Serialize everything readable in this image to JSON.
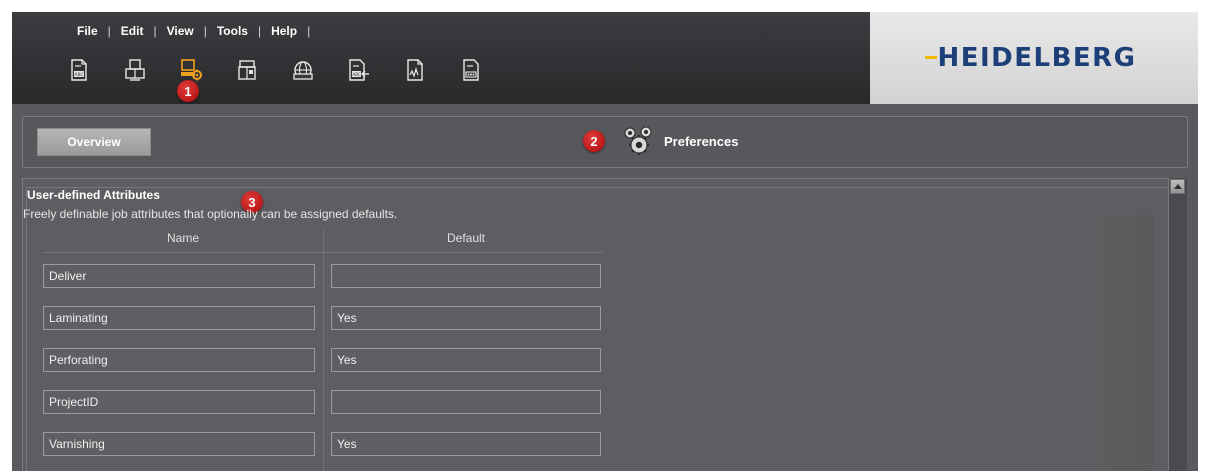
{
  "menu": {
    "items": [
      "File",
      "Edit",
      "View",
      "Tools",
      "Help"
    ],
    "separator": "|"
  },
  "toolbar": {
    "icons": [
      "abc-document-icon",
      "printer-icon",
      "preferences-monitor-icon",
      "printing-press-icon",
      "globe-printer-icon",
      "abc-export-icon",
      "signed-document-icon",
      "serial-document-icon"
    ],
    "active_index": 2,
    "active_color": "#f0a020"
  },
  "brand": {
    "logo_text": "HEIDELBERG",
    "logo_color": "#1c3f7a",
    "accent_color": "#f0b800"
  },
  "callouts": [
    "1",
    "2",
    "3"
  ],
  "tabs": {
    "overview_label": "Overview",
    "preferences_label": "Preferences"
  },
  "attributes_group": {
    "title": "User-defined Attributes",
    "description": "Freely definable job attributes that optionally can be assigned defaults.",
    "columns": [
      "Name",
      "Default"
    ],
    "rows": [
      {
        "name": "Deliver",
        "default": ""
      },
      {
        "name": "Laminating",
        "default": "Yes"
      },
      {
        "name": "Perforating",
        "default": "Yes"
      },
      {
        "name": "ProjectID",
        "default": ""
      },
      {
        "name": "Varnishing",
        "default": "Yes"
      }
    ]
  }
}
